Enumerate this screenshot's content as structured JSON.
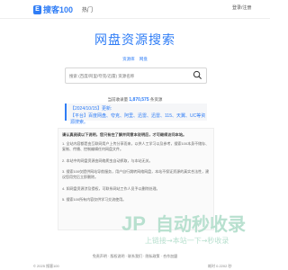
{
  "header": {
    "logo_mark": "E",
    "logo_text": "搜客100",
    "nav_hot": "热门",
    "login_label": "登录/注册"
  },
  "hero": {
    "title": "网盘资源搜索",
    "tagline_prefix": "",
    "tagline_items": [
      "资源库",
      "网盘"
    ]
  },
  "search": {
    "placeholder": "搜索 (百度/阿里/夸克/迅雷) 资源名称"
  },
  "stats": {
    "prefix": "当前收录量",
    "count": "1,870,575",
    "suffix": "条资源"
  },
  "notice": {
    "line1": "【2024/10/15】更新:",
    "line2": "【平台】百度网盘、夸克、阿里、迅雷、迅雷、115、天翼、UC等资源搜索。"
  },
  "tips": {
    "heading": "请认真阅读以下说明，您只有在了解并同意本说明后，才可继续访问本站。",
    "items": [
      "1. 全站内容都是由互联网用户上传分享而来，以供人工学习以及参考，搜索100本身不储存、复制、传播、控制编辑任何网盘文件。",
      "2. 本站中的网盘资源由网络爬虫自动抓取，与本站无关。",
      "3. 搜索100仅提供网站导航服务，用户自行跳转网络网盘，本站不保证资源的真实合法性，建议您用完后立即删除。",
      "4. 如网盘资源涉及侵权，可联系网站工作人员予以删除处理。",
      "5. 搜索100所有内容仅供学习交流使用。"
    ]
  },
  "footer": {
    "links": "免责声明 · 版权说明 · 联系我们 · 隐私政策 · 合作加盟",
    "left": "© 2025 搜客100",
    "right": "耗时 0.2202 秒"
  },
  "watermark": {
    "text": "自动秒收录",
    "sub": "上链接→本站一下→秒收录"
  },
  "colors": {
    "accent": "#2f7df6",
    "watermark": "#b8e0cf"
  }
}
